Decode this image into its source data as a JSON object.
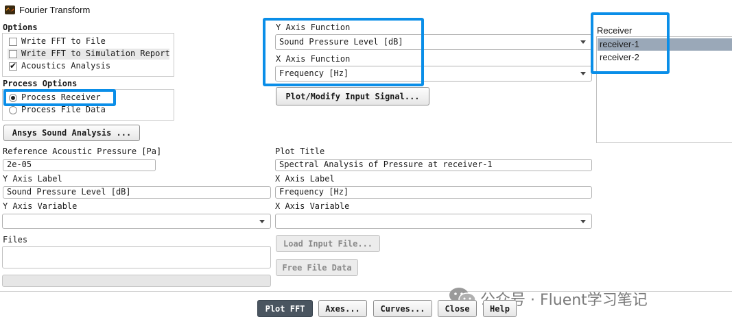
{
  "window": {
    "title": "Fourier Transform"
  },
  "options": {
    "heading": "Options",
    "items": [
      {
        "label": "Write FFT to File",
        "checked": false
      },
      {
        "label": "Write FFT to Simulation Report",
        "checked": false
      },
      {
        "label": "Acoustics Analysis",
        "checked": true
      }
    ]
  },
  "process_options": {
    "heading": "Process Options",
    "items": [
      {
        "label": "Process Receiver",
        "selected": true
      },
      {
        "label": "Process File Data",
        "selected": false
      }
    ]
  },
  "buttons": {
    "ansys_sound": "Ansys Sound Analysis ...",
    "plot_modify": "Plot/Modify Input Signal...",
    "load_input": "Load Input File...",
    "free_file": "Free File Data",
    "plot_fft": "Plot FFT",
    "axes": "Axes...",
    "curves": "Curves...",
    "close": "Close",
    "help": "Help"
  },
  "y_axis_function": {
    "label": "Y Axis Function",
    "value": "Sound Pressure Level [dB]"
  },
  "x_axis_function": {
    "label": "X Axis Function",
    "value": "Frequency [Hz]"
  },
  "receiver": {
    "label": "Receiver",
    "items": [
      "receiver-1",
      "receiver-2"
    ],
    "selected": "receiver-1"
  },
  "reference_pressure": {
    "label": "Reference Acoustic Pressure [Pa]",
    "value": "2e-05"
  },
  "plot_title": {
    "label": "Plot Title",
    "value": "Spectral Analysis of Pressure at receiver-1"
  },
  "y_axis_label": {
    "label": "Y Axis Label",
    "value": "Sound Pressure Level [dB]"
  },
  "x_axis_label": {
    "label": "X Axis Label",
    "value": "Frequency [Hz]"
  },
  "y_axis_variable": {
    "label": "Y Axis Variable",
    "value": ""
  },
  "x_axis_variable": {
    "label": "X Axis Variable",
    "value": ""
  },
  "files": {
    "label": "Files"
  },
  "watermark": {
    "text": "公众号 · Fluent学习笔记"
  },
  "colors": {
    "annotation": "#0a8ee8",
    "selection": "#9aa8b8",
    "primary_button": "#4a5560"
  }
}
